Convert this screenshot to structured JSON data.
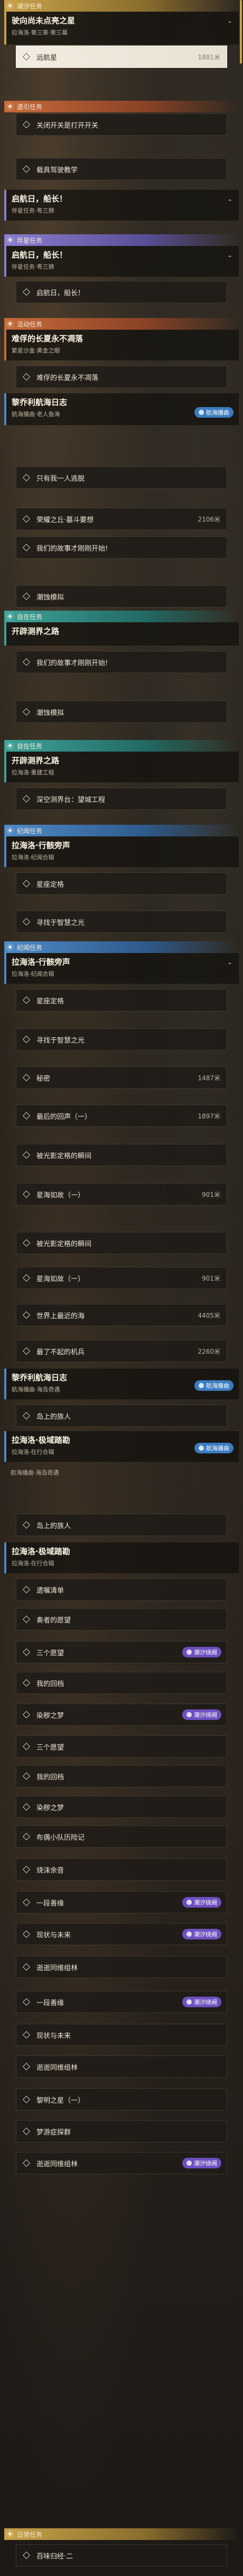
{
  "sections": {
    "chaosu": "潮汐任务",
    "xianshi": "遗引任务",
    "banxing": "伴星任务",
    "huodong": "活动任务",
    "zizai": "自在任务",
    "jihang": "纪闻任务",
    "richang": "日常任务"
  },
  "q1": {
    "title": "驶向尚未点亮之星",
    "sub": "拉海洛·第三章·第三幕"
  },
  "q1_steps": [
    {
      "label": "远航星",
      "dist": "1881米"
    },
    {
      "label": "关闭开关是打开开关",
      "dist": ""
    },
    {
      "label": "载具驾驶教学",
      "dist": ""
    }
  ],
  "q2": {
    "title": "启航日，船长！",
    "sub": "伴星任务·粤三狮"
  },
  "q2b": {
    "title": "启航日，船长！",
    "sub": "伴星任务·粤三狮"
  },
  "q2b_step": "启航日，船长！",
  "q3": {
    "title": "难俘的长夏永不凋落",
    "sub": "繁星沙盒·黄金之眼"
  },
  "q3_step": "难俘的长夏永不凋落",
  "q4": {
    "title": "黎乔利航海日志",
    "sub": "航海播曲·老人鱼海"
  },
  "q4_tag": "航海播曲",
  "q4_steps": [
    {
      "label": "只有我一人逃脱",
      "dist": ""
    },
    {
      "label": "荣耀之丘·墓斗要想",
      "dist": "2106米"
    },
    {
      "label": "我们的故事才刚刚开始!",
      "dist": ""
    },
    {
      "label": "潮蚀模拟",
      "dist": ""
    }
  ],
  "q5": {
    "title": "开辟测界之路",
    "sub": "拉海洛·重建工程"
  },
  "q5_steps": [
    {
      "label": "我们的故事才刚刚开始!",
      "dist": ""
    },
    {
      "label": "潮蚀模拟",
      "dist": ""
    }
  ],
  "q6": {
    "title": "开辟测界之路",
    "sub": "拉海洛·重建工程"
  },
  "q6_step": "深空测界台：望城工程",
  "q7": {
    "title": "拉海洛·行骸旁声",
    "sub": "拉海洛·纪闻合辑"
  },
  "q7_steps": [
    {
      "label": "星座定格",
      "dist": ""
    },
    {
      "label": "寻找于智慧之光",
      "dist": ""
    }
  ],
  "q8": {
    "title": "拉海洛·行骸旁声",
    "sub": "拉海洛·纪闻合辑"
  },
  "q8_steps": [
    {
      "label": "星座定格",
      "dist": ""
    },
    {
      "label": "寻找于智慧之光",
      "dist": ""
    },
    {
      "label": "秘密",
      "dist": "1487米"
    },
    {
      "label": "最后的回声（一）",
      "dist": "1897米"
    },
    {
      "label": "被光影定格的瞬间",
      "dist": ""
    },
    {
      "label": "星海如故（一）",
      "dist": "901米"
    },
    {
      "label": "被光影定格的瞬间",
      "dist": ""
    },
    {
      "label": "星海如故（一）",
      "dist": "901米"
    },
    {
      "label": "世界上最近的海",
      "dist": "4405米"
    },
    {
      "label": "最了不起的机兵",
      "dist": "2260米"
    }
  ],
  "q9": {
    "title": "黎乔利航海日志",
    "sub": "航海播曲·海岛奇遇"
  },
  "q9_tag": "航海播曲",
  "q9_step": "岛上的族人",
  "q10": {
    "title": "拉海洛·极域踏勘",
    "sub": "拉海洛·在行合辑"
  },
  "q10_tag": "航海播曲",
  "q10_sub2": "航海播曲·海岛奇遇",
  "q10_steps": [
    {
      "label": "岛上的族人",
      "dist": ""
    }
  ],
  "q11": {
    "title": "拉海洛·极域踏勘",
    "sub": "拉海洛·在行合辑"
  },
  "q11_steps": [
    {
      "label": "遗嘱清单",
      "dist": "",
      "tag": ""
    },
    {
      "label": "奏者的愿望",
      "dist": "",
      "tag": ""
    },
    {
      "label": "三个愿望",
      "dist": "",
      "tag": "潮汐绕阙"
    },
    {
      "label": "我的回档",
      "dist": "",
      "tag": ""
    },
    {
      "label": "染秽之梦",
      "dist": "",
      "tag": "潮汐绕阙"
    },
    {
      "label": "三个愿望",
      "dist": "",
      "tag": ""
    },
    {
      "label": "我的回档",
      "dist": "",
      "tag": ""
    },
    {
      "label": "染秽之梦",
      "dist": "",
      "tag": ""
    },
    {
      "label": "布偶小队历险记",
      "dist": "",
      "tag": ""
    },
    {
      "label": "烧沫余音",
      "dist": "",
      "tag": ""
    },
    {
      "label": "一段善缘",
      "dist": "",
      "tag": "潮汐绕阙"
    },
    {
      "label": "现状与未来",
      "dist": "",
      "tag": "潮汐绕阙"
    },
    {
      "label": "逝逝同维组林",
      "dist": "",
      "tag": ""
    },
    {
      "label": "一段善缘",
      "dist": "",
      "tag": "潮汐绕阙"
    },
    {
      "label": "现状与未来",
      "dist": "",
      "tag": ""
    },
    {
      "label": "逝逝同维组林",
      "dist": "",
      "tag": ""
    },
    {
      "label": "黎明之星（一）",
      "dist": "",
      "tag": ""
    },
    {
      "label": "梦游症探群",
      "dist": "",
      "tag": ""
    },
    {
      "label": "逝逝同维组林",
      "dist": "",
      "tag": "潮汐绕阙"
    }
  ],
  "q12_step": "百味归经·二"
}
